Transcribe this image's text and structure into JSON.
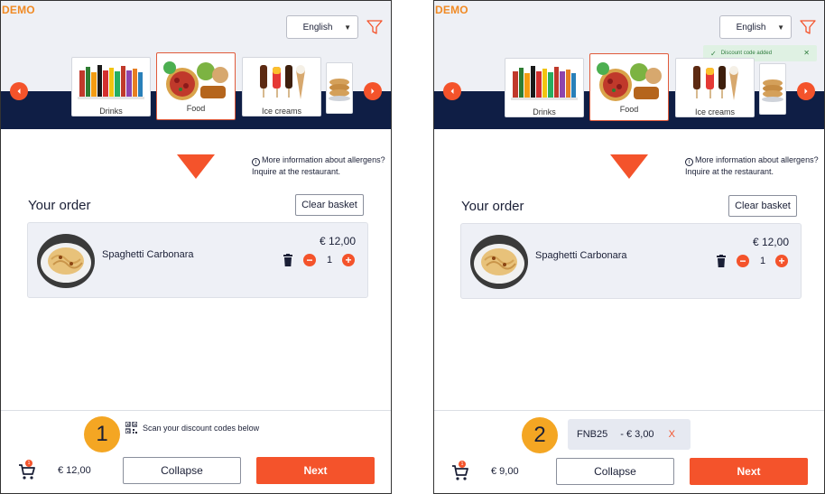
{
  "colors": {
    "accent": "#f4532b",
    "navy": "#0f1e45",
    "badge": "#f4a623",
    "logo": "#f08a24",
    "toast_bg": "#dff1e3"
  },
  "panel1": {
    "logo": "DEMO",
    "language": "English",
    "categories": [
      {
        "label": "Drinks",
        "icon": "drinks-image"
      },
      {
        "label": "Food",
        "icon": "food-image"
      },
      {
        "label": "Ice creams",
        "icon": "ice-creams-image"
      },
      {
        "label": "",
        "icon": "pancakes-image"
      }
    ],
    "allergen_info": "More information about allergens? Inquire at the restaurant.",
    "order_title": "Your order",
    "clear_basket": "Clear basket",
    "item": {
      "name": "Spaghetti Carbonara",
      "price": "€ 12,00",
      "quantity": "1"
    },
    "scan_text": "Scan your discount codes below",
    "step_number": "1",
    "cart_count": "1",
    "total": "€ 12,00",
    "collapse": "Collapse",
    "next": "Next"
  },
  "panel2": {
    "logo": "DEMO",
    "language": "English",
    "toast": "Discount code added",
    "categories": [
      {
        "label": "Drinks",
        "icon": "drinks-image"
      },
      {
        "label": "Food",
        "icon": "food-image"
      },
      {
        "label": "Ice creams",
        "icon": "ice-creams-image"
      },
      {
        "label": "",
        "icon": "pancakes-image"
      }
    ],
    "allergen_info": "More information about allergens? Inquire at the restaurant.",
    "order_title": "Your order",
    "clear_basket": "Clear basket",
    "item": {
      "name": "Spaghetti Carbonara",
      "price": "€ 12,00",
      "quantity": "1"
    },
    "discount": {
      "code": "FNB25",
      "amount": "- € 3,00",
      "remove": "X"
    },
    "step_number": "2",
    "cart_count": "1",
    "total": "€ 9,00",
    "collapse": "Collapse",
    "next": "Next"
  }
}
